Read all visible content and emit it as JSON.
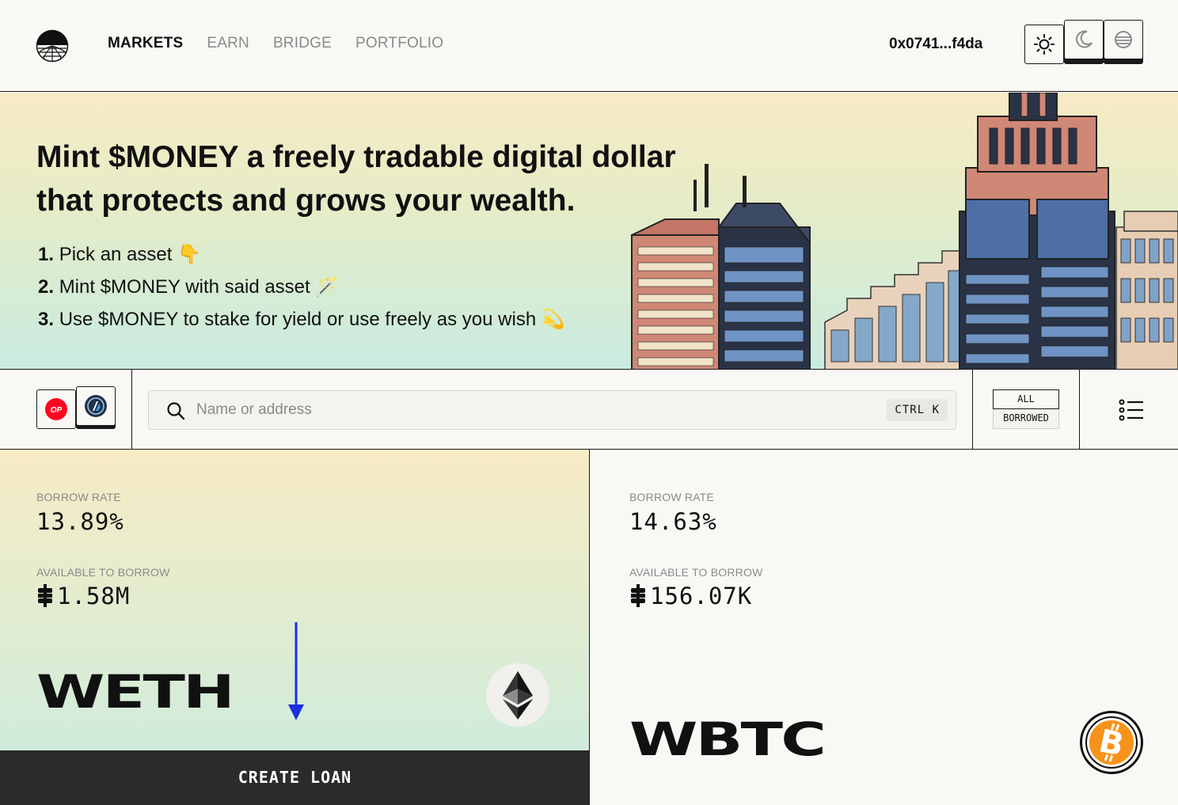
{
  "header": {
    "logo": "sunset-globe-logo",
    "nav": [
      {
        "label": "MARKETS",
        "active": true
      },
      {
        "label": "EARN",
        "active": false
      },
      {
        "label": "BRIDGE",
        "active": false
      },
      {
        "label": "PORTFOLIO",
        "active": false
      }
    ],
    "wallet": "0x0741...f4da",
    "theme_options": [
      "sun-icon",
      "moon-icon",
      "globe-icon"
    ]
  },
  "hero": {
    "title_pre": "Mint ",
    "title_brand": "$MONEY",
    "title_post": " a freely tradable digital dollar that protects and grows your wealth.",
    "steps": [
      {
        "num": "1.",
        "text": "Pick an asset",
        "emoji": "👇"
      },
      {
        "num": "2.",
        "text": "Mint $MONEY with said asset",
        "emoji": "🪄"
      },
      {
        "num": "3.",
        "text": "Use $MONEY to stake for yield or use freely as you wish",
        "emoji": "💫"
      }
    ]
  },
  "filters": {
    "chains": [
      {
        "name": "OP",
        "color": "#ff0420"
      },
      {
        "name": "Arbitrum",
        "color": "#213147"
      }
    ],
    "search_placeholder": "Name or address",
    "shortcut": "CTRL K",
    "toggle": {
      "on": "ALL",
      "off": "BORROWED"
    }
  },
  "markets": [
    {
      "asset": "WETH",
      "borrow_rate_label": "BORROW RATE",
      "borrow_rate": "13.89%",
      "available_label": "AVAILABLE TO BORROW",
      "available": "1.58M",
      "action": "CREATE  LOAN"
    },
    {
      "asset": "WBTC",
      "borrow_rate_label": "BORROW RATE",
      "borrow_rate": "14.63%",
      "available_label": "AVAILABLE TO BORROW",
      "available": "156.07K"
    }
  ],
  "colors": {
    "accent_arrow": "#1a2fe0",
    "btc_orange": "#f7931a",
    "dark": "#2b2b2b"
  }
}
